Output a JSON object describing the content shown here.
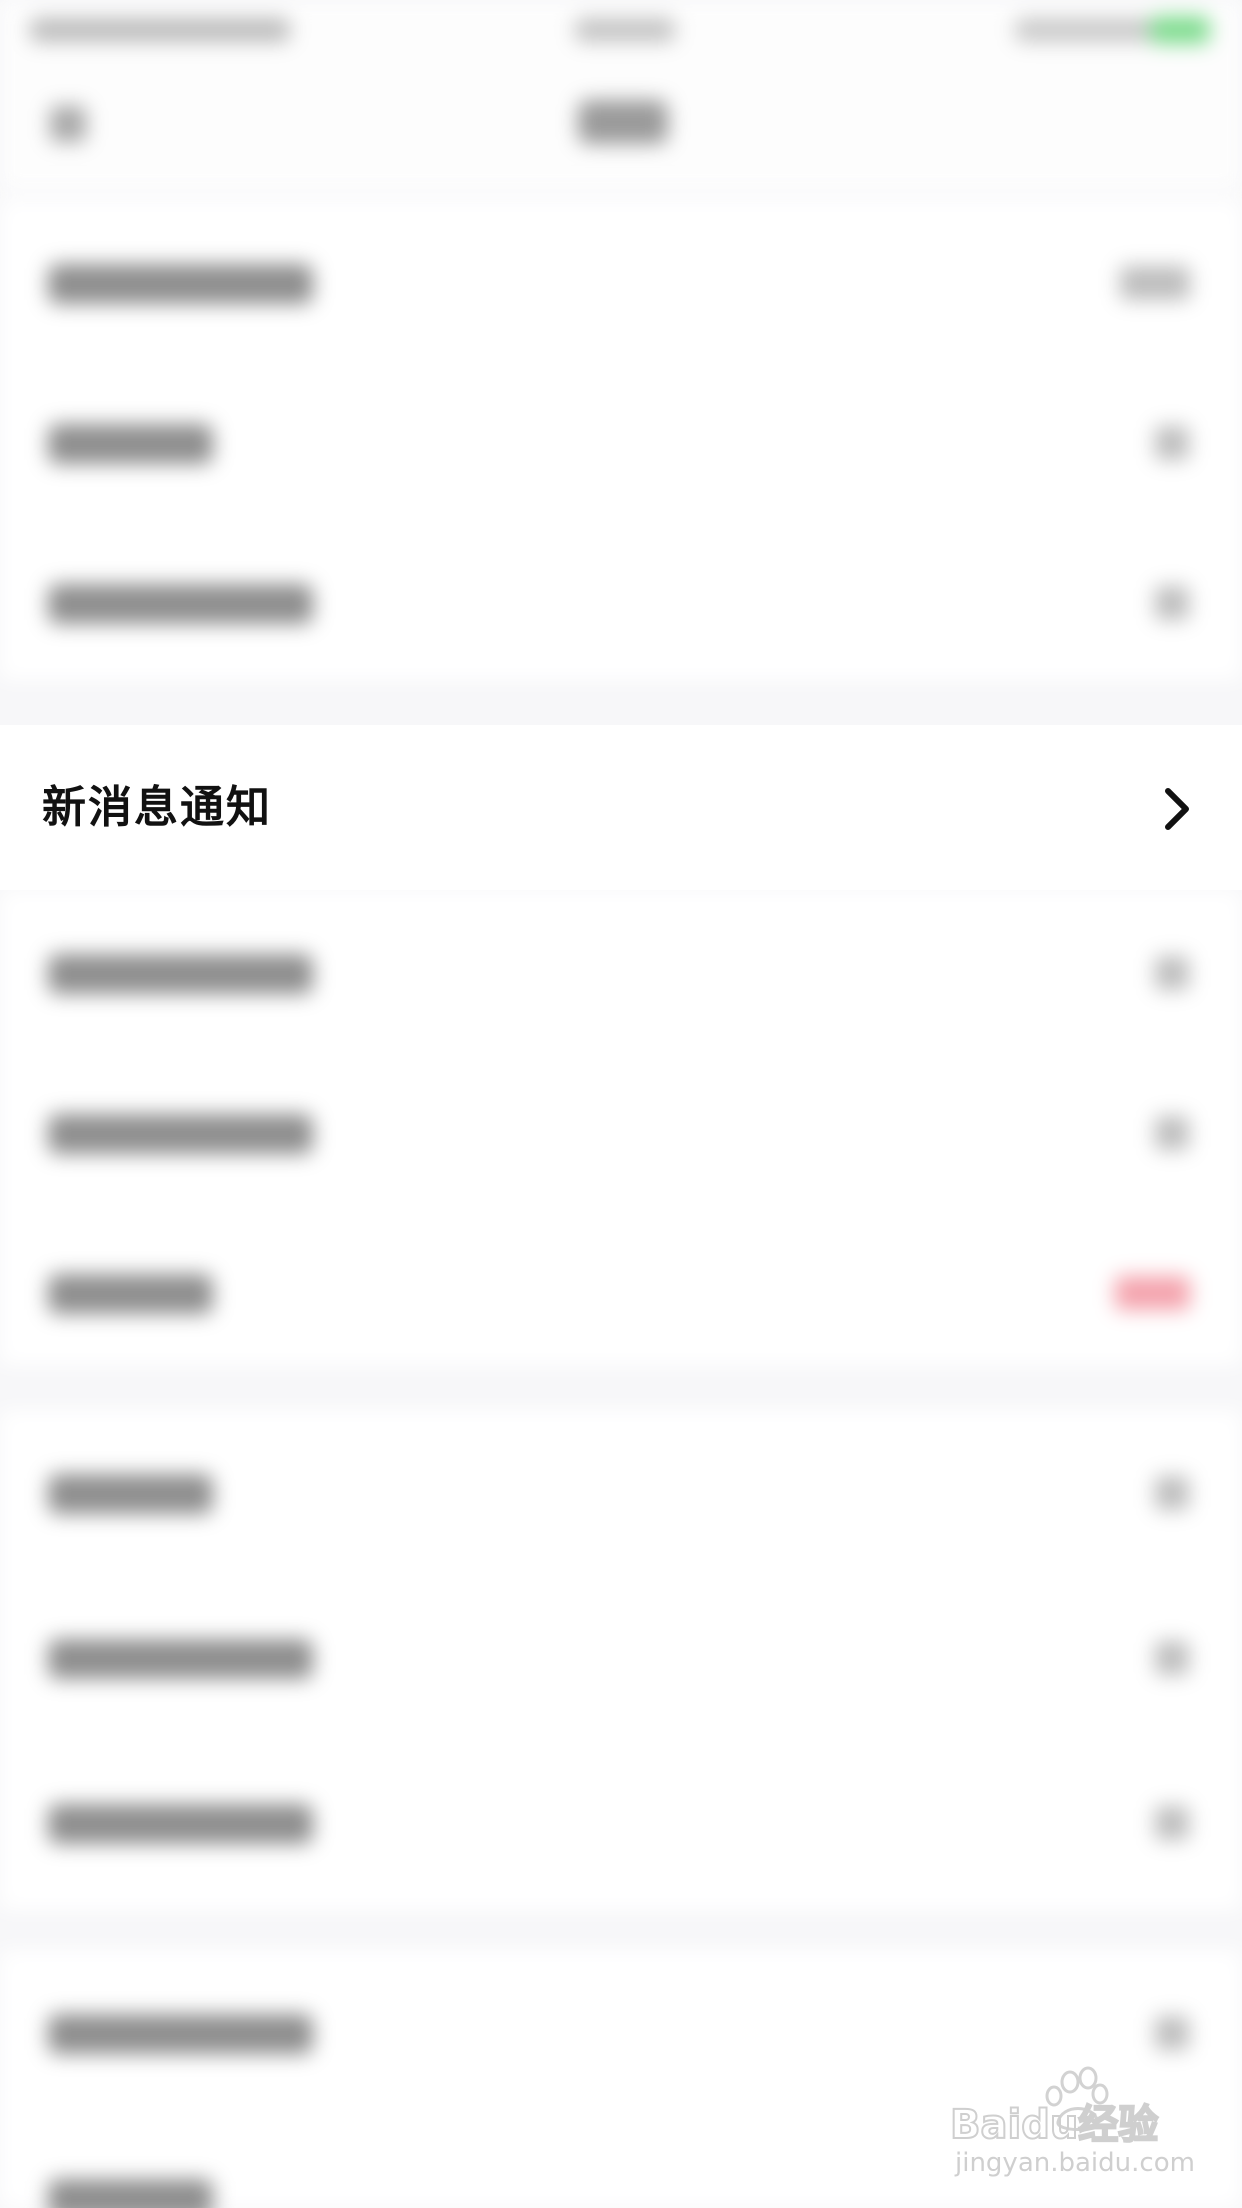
{
  "settings": {
    "highlighted_item": {
      "label": "新消息通知",
      "icon": "chevron-right-icon"
    },
    "blurred_rows": 12
  },
  "watermark": {
    "brand": "Baidu经验",
    "url": "jingyan.baidu.com"
  },
  "colors": {
    "background": "#f7f7f9",
    "row": "#ffffff",
    "text": "#111111",
    "battery": "#4cd964",
    "badge": "#fa5151"
  }
}
